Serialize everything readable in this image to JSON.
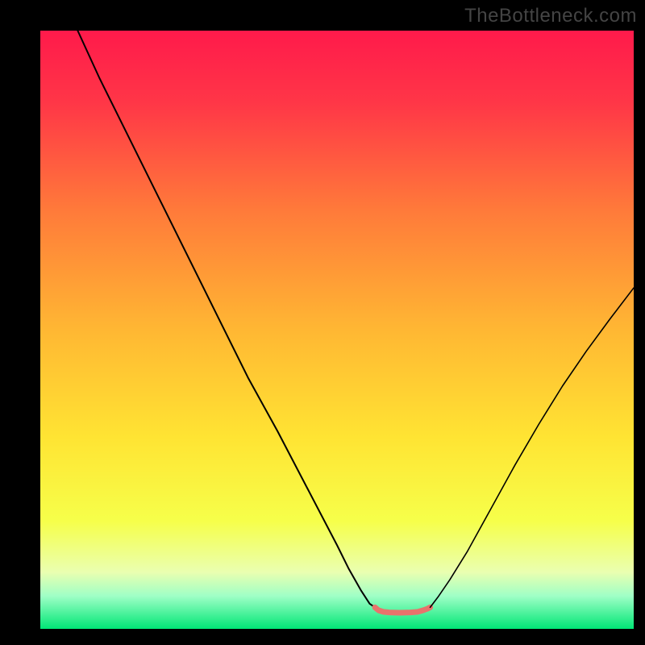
{
  "watermark": "TheBottleneck.com",
  "chart_data": {
    "type": "line",
    "title": "",
    "xlabel": "",
    "ylabel": "",
    "xlim": [
      0,
      100
    ],
    "ylim": [
      0,
      100
    ],
    "grid": false,
    "legend": false,
    "background_gradient_stops": [
      {
        "offset": 0.0,
        "color": "#ff1a4b"
      },
      {
        "offset": 0.12,
        "color": "#ff3647"
      },
      {
        "offset": 0.3,
        "color": "#ff7a3a"
      },
      {
        "offset": 0.5,
        "color": "#ffb733"
      },
      {
        "offset": 0.68,
        "color": "#ffe433"
      },
      {
        "offset": 0.82,
        "color": "#f6ff4a"
      },
      {
        "offset": 0.905,
        "color": "#eaffb0"
      },
      {
        "offset": 0.945,
        "color": "#9fffc6"
      },
      {
        "offset": 1.0,
        "color": "#00e676"
      }
    ],
    "series": [
      {
        "name": "left-branch",
        "stroke": "#000000",
        "stroke_width": 2,
        "x": [
          6.3,
          10,
          15,
          20,
          25,
          30,
          35,
          40,
          45,
          50,
          52,
          54,
          55.5,
          56.4
        ],
        "y": [
          100,
          92,
          82,
          72,
          62,
          52,
          42,
          33,
          23.5,
          14,
          10,
          6.5,
          4.2,
          3.6
        ]
      },
      {
        "name": "valley-floor",
        "stroke": "#e8736c",
        "stroke_width": 7,
        "x": [
          56.4,
          57.0,
          57.8,
          58.8,
          60.5,
          62.4,
          63.6,
          64.5,
          65.2,
          65.7
        ],
        "y": [
          3.6,
          3.1,
          2.85,
          2.75,
          2.7,
          2.75,
          2.85,
          3.1,
          3.35,
          3.6
        ]
      },
      {
        "name": "right-branch",
        "stroke": "#000000",
        "stroke_width": 1.6,
        "x": [
          65.7,
          67,
          69,
          72,
          76,
          80,
          84,
          88,
          92,
          96,
          100
        ],
        "y": [
          3.6,
          5.3,
          8.2,
          13,
          20.2,
          27.4,
          34.2,
          40.6,
          46.4,
          51.8,
          57
        ]
      }
    ]
  }
}
